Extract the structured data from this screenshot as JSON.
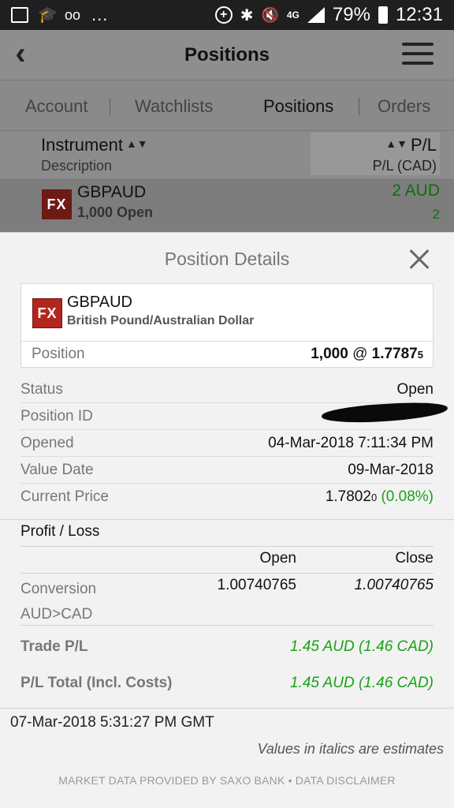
{
  "status_bar": {
    "battery": "79%",
    "time": "12:31",
    "network": "4G",
    "ellipsis": "...",
    "icons": [
      "image-icon",
      "school-icon",
      "voicemail-icon",
      "data-saver-icon",
      "bluetooth-icon",
      "mute-icon",
      "signal-icon",
      "battery-icon"
    ]
  },
  "header": {
    "title": "Positions",
    "back_icon": "chevron-left-icon",
    "menu_icon": "hamburger-menu-icon"
  },
  "tabs": [
    {
      "label": "Account"
    },
    {
      "label": "Watchlists"
    },
    {
      "label": "Positions"
    },
    {
      "label": "Orders"
    }
  ],
  "list_header": {
    "instrument": "Instrument",
    "description": "Description",
    "pl": "P/L",
    "pl_cad": "P/L (CAD)"
  },
  "list_row": {
    "badge": "FX",
    "symbol": "GBPAUD",
    "open": "1,000 Open",
    "pl": "2 AUD",
    "pl_cad": "2"
  },
  "details": {
    "title": "Position Details",
    "card": {
      "badge": "FX",
      "symbol": "GBPAUD",
      "description": "British Pound/Australian Dollar",
      "position_label": "Position",
      "position_qty": "1,000",
      "position_at": "@",
      "position_price": "1.7787",
      "position_price_small": "5"
    },
    "rows": {
      "status_label": "Status",
      "status_value": "Open",
      "position_id_label": "Position ID",
      "opened_label": "Opened",
      "opened_value": "04-Mar-2018 7:11:34 PM",
      "value_date_label": "Value Date",
      "value_date_value": "09-Mar-2018",
      "current_price_label": "Current Price",
      "current_price_value": "1.7802",
      "current_price_small": "0",
      "current_price_change": "(0.08%)"
    },
    "profit_loss": {
      "title": "Profit / Loss",
      "open_header": "Open",
      "close_header": "Close",
      "conversion_label": "Conversion",
      "conversion_pair": "AUD>CAD",
      "conversion_open": "1.00740765",
      "conversion_close": "1.00740765",
      "trade_pl_label": "Trade P/L",
      "trade_pl_value": "1.45 AUD (1.46 CAD)",
      "pl_total_label": "P/L Total (Incl. Costs)",
      "pl_total_value": "1.45 AUD (1.46 CAD)"
    },
    "timestamp": "07-Mar-2018 5:31:27 PM GMT",
    "note": "Values in italics are estimates",
    "footer": "MARKET DATA PROVIDED BY SAXO BANK • DATA DISCLAIMER"
  }
}
